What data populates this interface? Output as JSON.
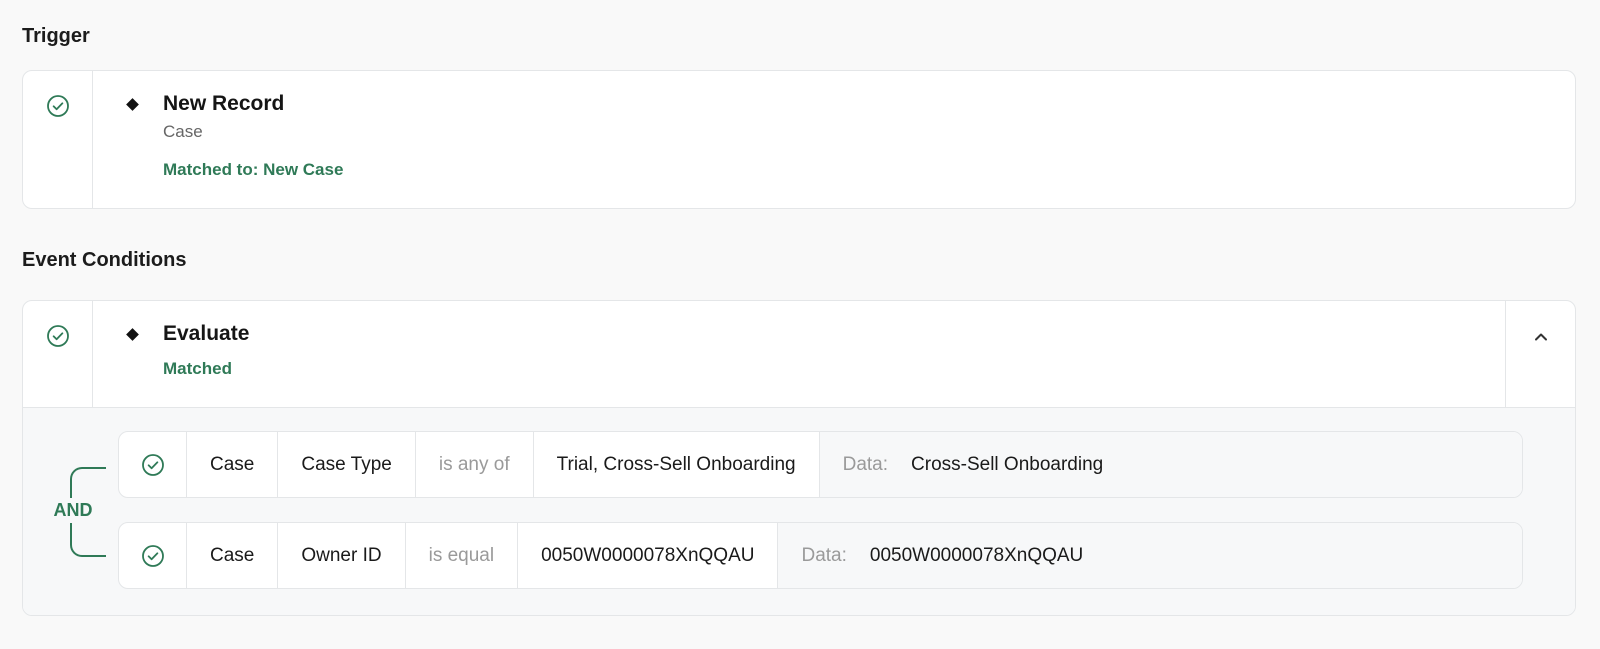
{
  "sections": {
    "trigger_title": "Trigger",
    "event_title": "Event Conditions"
  },
  "trigger": {
    "title": "New Record",
    "object": "Case",
    "match": "Matched to: New Case"
  },
  "evaluate": {
    "title": "Evaluate",
    "match": "Matched",
    "logic": "AND",
    "conditions": [
      {
        "object": "Case",
        "field": "Case Type",
        "operator": "is any of",
        "value": "Trial, Cross-Sell Onboarding",
        "data_label": "Data:",
        "data_value": "Cross-Sell Onboarding"
      },
      {
        "object": "Case",
        "field": "Owner ID",
        "operator": "is equal",
        "value": "0050W0000078XnQQAU",
        "data_label": "Data:",
        "data_value": "0050W0000078XnQQAU"
      }
    ]
  },
  "colors": {
    "success": "#2f7a57",
    "border": "#e4e6e8",
    "muted": "#9a9a9a"
  },
  "icons": {
    "status": "check-circle-icon",
    "bullet": "diamond-icon",
    "collapse": "chevron-up-icon"
  }
}
